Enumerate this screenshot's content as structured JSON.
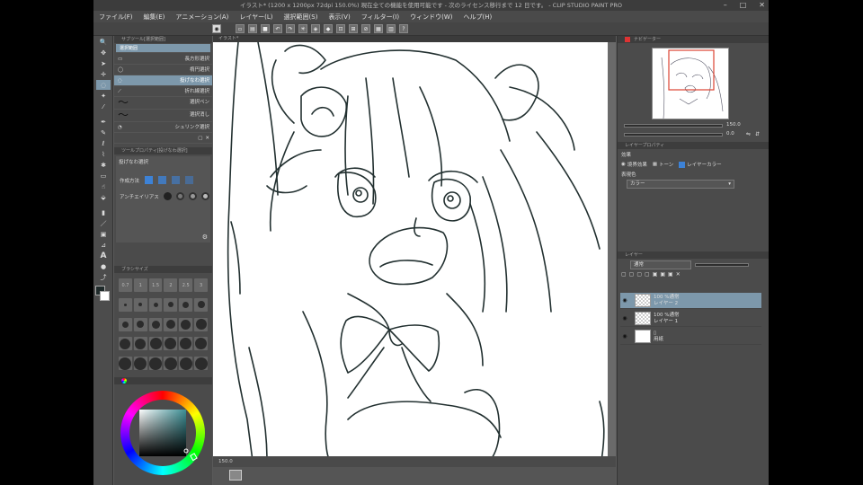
{
  "titlebar": {
    "text": "イラスト* (1200 x 1200px 72dpi 150.0%) 現在全ての機能を使用可能です - 次のライセンス移行まで 12 日です。 - CLIP STUDIO PAINT PRO"
  },
  "menu": [
    "ファイル(F)",
    "編集(E)",
    "アニメーション(A)",
    "レイヤー(L)",
    "選択範囲(S)",
    "表示(V)",
    "フィルター(I)",
    "ウィンドウ(W)",
    "ヘルプ(H)"
  ],
  "canvas_tab": "イラスト*",
  "subtool": {
    "header": "サブツール[選択範囲]",
    "active_tab": "選択範囲",
    "items": [
      {
        "label": "長方形選択"
      },
      {
        "label": "楕円選択"
      },
      {
        "label": "投げなわ選択"
      },
      {
        "label": "折れ線選択"
      },
      {
        "label": "選択ペン"
      },
      {
        "label": "選択消し"
      },
      {
        "label": "シュリンク選択"
      }
    ],
    "active_index": 2
  },
  "tool_property": {
    "header": "ツールプロパティ[投げなわ選択]",
    "tool_name": "投げなわ選択",
    "rows": [
      "作成方法",
      "アンチエイリアス"
    ]
  },
  "brushsize": {
    "header": "ブラシサイズ",
    "labels": [
      "0.7",
      "1",
      "1.5",
      "2",
      "2.5",
      "3"
    ]
  },
  "color": {
    "main": "#1f2a2a",
    "accent": "#2f4b4f"
  },
  "status": {
    "zoom": "150.0"
  },
  "navigator": {
    "header": "ナビゲーター",
    "zoom": "150.0",
    "angle": "0.0"
  },
  "layer_property": {
    "header": "レイヤープロパティ",
    "effect_label": "効果",
    "effect1": "境界効果",
    "effect2": "トーン",
    "expr_label": "表現色",
    "expr_value": "カラー",
    "layer_color_button": "レイヤーカラー"
  },
  "layer_panel": {
    "header": "レイヤー",
    "blend": "通常",
    "layers": [
      {
        "pct": "100 %通常",
        "name": "レイヤー 2",
        "active": true,
        "paper": false
      },
      {
        "pct": "100 %通常",
        "name": "レイヤー 1",
        "active": false,
        "paper": false
      },
      {
        "pct": "",
        "name": "用紙",
        "active": false,
        "paper": true
      }
    ]
  }
}
